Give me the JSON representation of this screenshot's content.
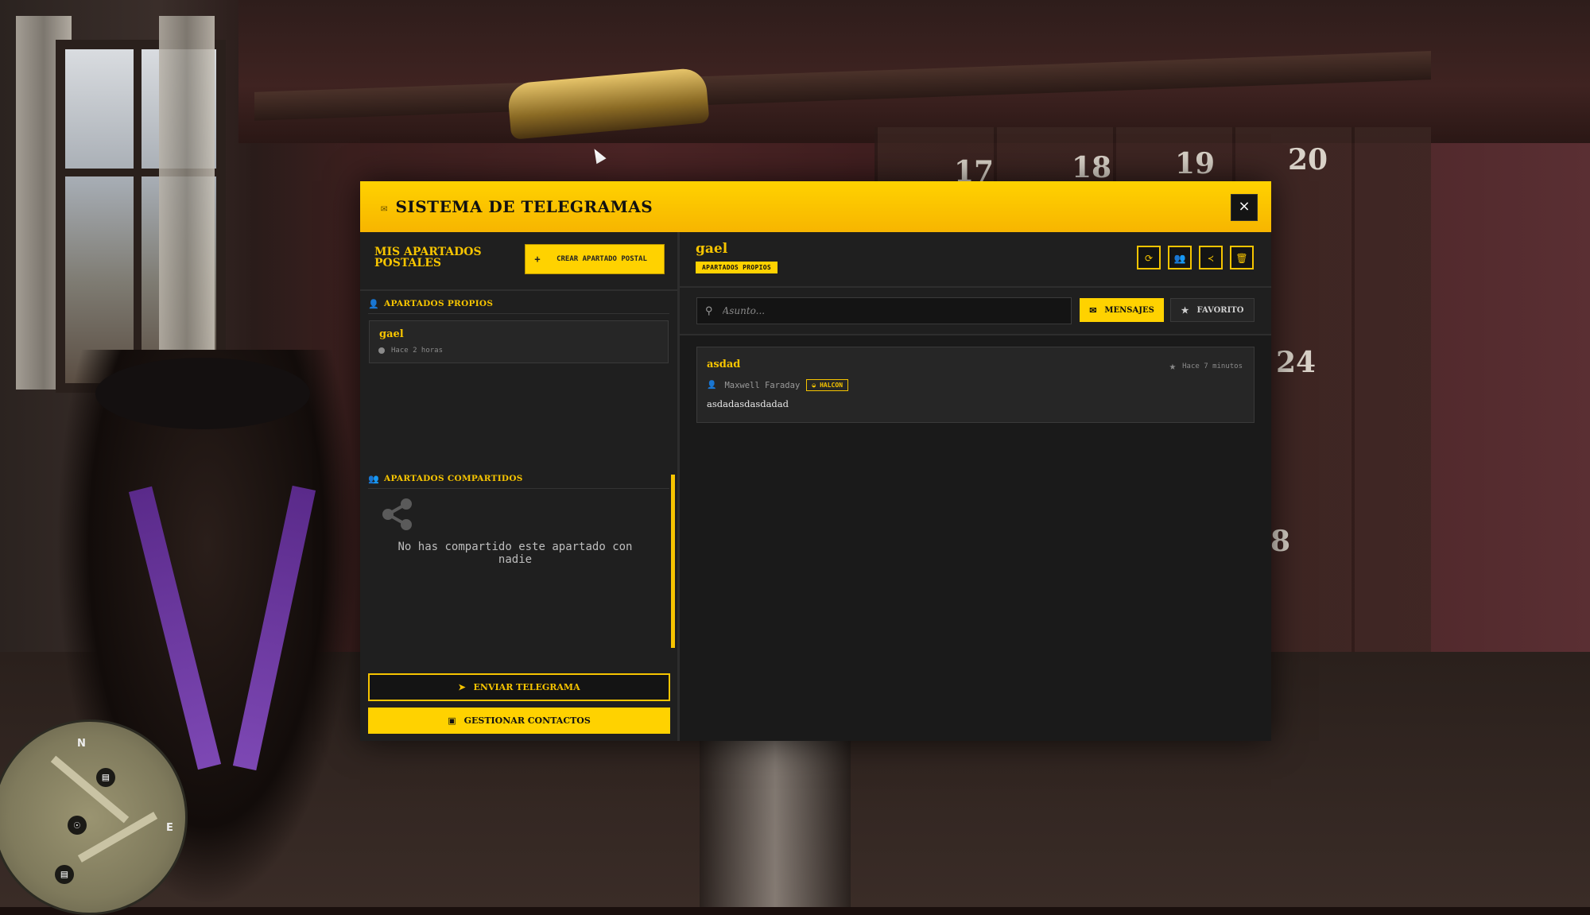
{
  "colors": {
    "accent": "#ffd200",
    "accent_text": "#f6c400",
    "panel": "#1f1f1f",
    "card": "#262626"
  },
  "modal": {
    "title": "SISTEMA DE TELEGRAMAS",
    "title_icon": "envelope-icon",
    "close_label": "×"
  },
  "sidebar": {
    "title": "MIS APARTADOS POSTALES",
    "create_button": {
      "icon": "plus-icon",
      "label": "CREAR APARTADO POSTAL"
    },
    "own_section": {
      "icon": "user-icon",
      "title": "APARTADOS PROPIOS",
      "items": [
        {
          "name": "gael",
          "time": "Hace 2 horas"
        }
      ]
    },
    "shared_section": {
      "icon": "users-icon",
      "title": "APARTADOS COMPARTIDOS",
      "empty_icon": "share-icon",
      "empty_text": "No has compartido este apartado con nadie"
    },
    "send_button": {
      "icon": "paper-plane-icon",
      "label": "ENVIAR TELEGRAMA"
    },
    "contacts_button": {
      "icon": "address-book-icon",
      "label": "GESTIONAR CONTACTOS"
    }
  },
  "mailbox": {
    "name": "gael",
    "badge": "APARTADOS PROPIOS",
    "tools": [
      "refresh-icon",
      "users-icon",
      "share-icon",
      "trash-icon"
    ],
    "search_placeholder": "Asunto...",
    "tabs": [
      {
        "icon": "envelope-icon",
        "label": "MENSAJES",
        "active": true
      },
      {
        "icon": "star-icon",
        "label": "FAVORITO",
        "active": false
      }
    ],
    "messages": [
      {
        "subject": "asdad",
        "time": "Hace 7 minutos",
        "sender": "Maxwell Faraday",
        "method": "HALCON",
        "body": "asdadasdasdadad"
      }
    ]
  },
  "hud": {
    "minimap_letters": [
      "N",
      "E"
    ]
  }
}
